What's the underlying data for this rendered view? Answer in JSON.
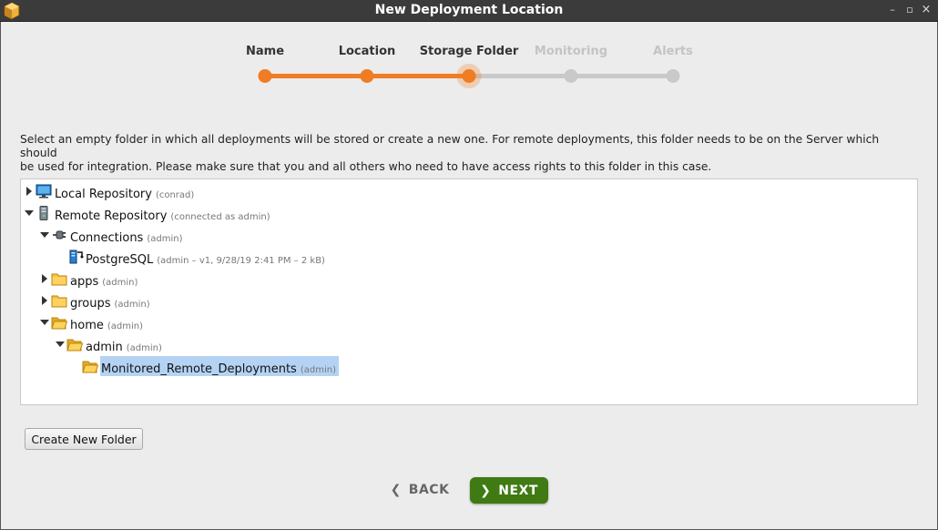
{
  "window": {
    "title": "New Deployment Location",
    "controls": {
      "minimize": "–",
      "maximize": "▫",
      "close": "×"
    }
  },
  "wizard": {
    "steps": [
      {
        "label": "Name",
        "state": "done"
      },
      {
        "label": "Location",
        "state": "done"
      },
      {
        "label": "Storage Folder",
        "state": "current"
      },
      {
        "label": "Monitoring",
        "state": "todo"
      },
      {
        "label": "Alerts",
        "state": "todo"
      }
    ],
    "accent_color": "#f07c23",
    "inactive_color": "#c9c9c9"
  },
  "description": {
    "line1": "Select an empty folder in which all deployments will be stored or create a new one. For remote deployments, this folder needs to be on the Server which should",
    "line2": "be used for integration. Please make sure that you and all others who need to have access rights to this folder in this case."
  },
  "tree": {
    "nodes": [
      {
        "label": "Local Repository",
        "meta": "(conrad)",
        "icon": "monitor-icon",
        "toggle": "collapsed"
      },
      {
        "label": "Remote Repository",
        "meta": "(connected as admin)",
        "icon": "server-icon",
        "toggle": "expanded"
      },
      {
        "label": "Connections",
        "meta": "(admin)",
        "icon": "plug-icon",
        "toggle": "expanded"
      },
      {
        "label": "PostgreSQL",
        "meta": "(admin – v1, 9/28/19 2:41 PM – 2 kB)",
        "icon": "database-connection-icon",
        "toggle": "none"
      },
      {
        "label": "apps",
        "meta": "(admin)",
        "icon": "folder-icon",
        "toggle": "collapsed"
      },
      {
        "label": "groups",
        "meta": "(admin)",
        "icon": "folder-icon",
        "toggle": "collapsed"
      },
      {
        "label": "home",
        "meta": "(admin)",
        "icon": "folder-open-icon",
        "toggle": "expanded"
      },
      {
        "label": "admin",
        "meta": "(admin)",
        "icon": "folder-open-icon",
        "toggle": "expanded"
      },
      {
        "label": "Monitored_Remote_Deployments",
        "meta": "(admin)",
        "icon": "folder-open-icon",
        "toggle": "none",
        "selected": true
      }
    ]
  },
  "buttons": {
    "create_folder": "Create New Folder",
    "back": "BACK",
    "next": "NEXT",
    "back_chevron": "❮",
    "next_chevron": "❯"
  }
}
